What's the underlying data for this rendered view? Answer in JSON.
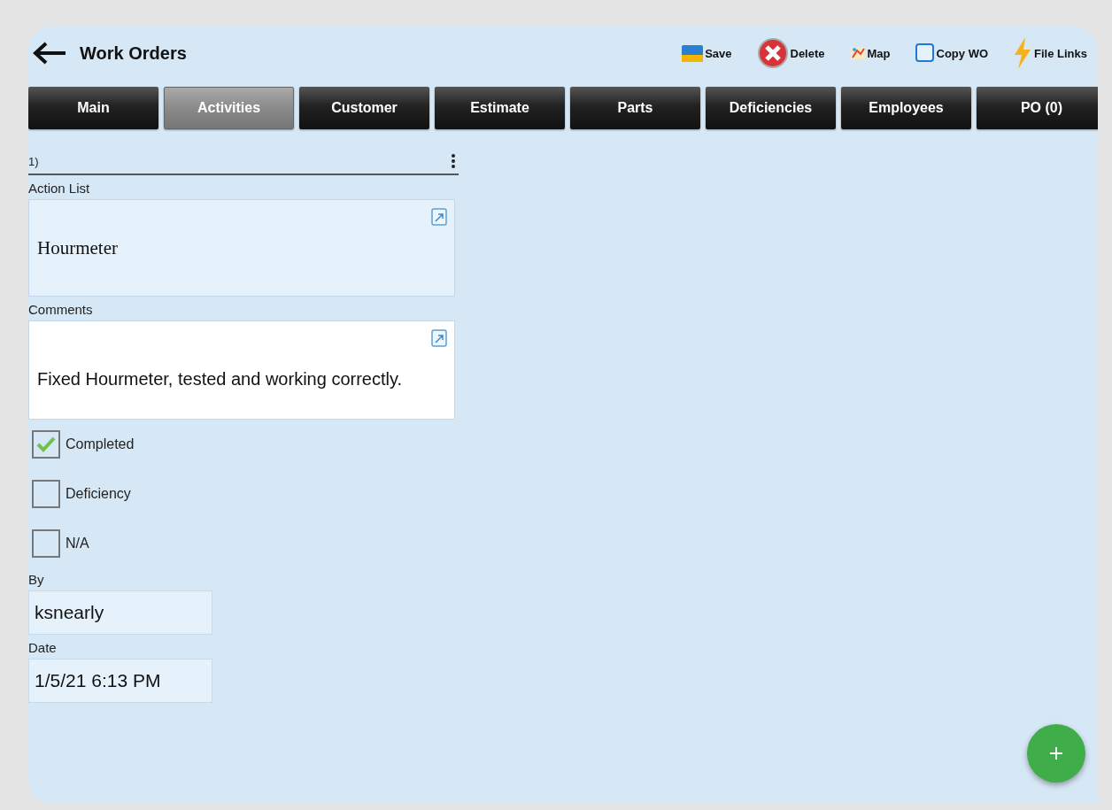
{
  "header": {
    "title": "Work Orders",
    "actions": [
      {
        "kind": "save",
        "label": "Save"
      },
      {
        "kind": "delete",
        "label": "Delete"
      },
      {
        "kind": "map",
        "label": "Map"
      },
      {
        "kind": "copy",
        "label": "Copy WO"
      },
      {
        "kind": "links",
        "label": "File Links"
      }
    ]
  },
  "tabs": [
    {
      "label": "Main",
      "selected": false
    },
    {
      "label": "Activities",
      "selected": true
    },
    {
      "label": "Customer",
      "selected": false
    },
    {
      "label": "Estimate",
      "selected": false
    },
    {
      "label": "Parts",
      "selected": false
    },
    {
      "label": "Deficiencies",
      "selected": false
    },
    {
      "label": "Employees",
      "selected": false
    },
    {
      "label": "PO (0)",
      "selected": false
    }
  ],
  "activity": {
    "number": "1)",
    "action_list": {
      "label": "Action List",
      "value": "Hourmeter"
    },
    "comments": {
      "label": "Comments",
      "value": "Fixed Hourmeter, tested and working correctly."
    },
    "checks": [
      {
        "label": "Completed",
        "checked": true
      },
      {
        "label": "Deficiency",
        "checked": false
      },
      {
        "label": "N/A",
        "checked": false
      }
    ],
    "by": {
      "label": "By",
      "value": "ksnearly"
    },
    "date": {
      "label": "Date",
      "value": "1/5/21 6:13 PM"
    }
  }
}
